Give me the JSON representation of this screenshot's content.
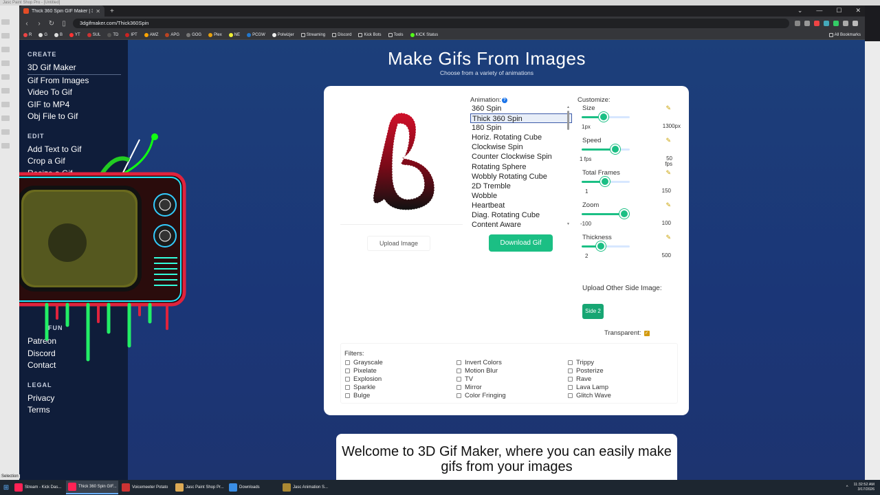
{
  "bg_app": {
    "title": "Jasc Paint Shop Pro - [Untitled]",
    "status": "Selection"
  },
  "browser": {
    "tab_title": "Thick 360 Spin GIF Maker | 3D GIF Maker",
    "url": "3dgifmaker.com/Thick360Spin",
    "bookmarks": [
      "R",
      "G",
      "B",
      "YT",
      "SUL",
      "TD",
      "IPT",
      "AMZ",
      "APG",
      "GOG",
      "Plex",
      "NE",
      "PCGW",
      "Polwizjer",
      "Streaming",
      "Discord",
      "Kick Bots",
      "Tools",
      "KICK Status"
    ],
    "all_bookmarks": "All Bookmarks"
  },
  "sidebar": {
    "create_title": "CREATE",
    "create_links": [
      "3D Gif Maker",
      "Gif From Images",
      "Video To Gif",
      "GIF to MP4",
      "Obj File to Gif"
    ],
    "edit_title": "EDIT",
    "edit_links": [
      "Add Text to Gif",
      "Crop a Gif",
      "Resize a Gif"
    ],
    "fun_title": "FUN",
    "fun_links": [
      "Patreon",
      "Discord",
      "Contact"
    ],
    "legal_title": "LEGAL",
    "legal_links": [
      "Privacy",
      "Terms"
    ]
  },
  "main": {
    "title": "Make Gifs From Images",
    "subtitle": "Choose from a variety of animations",
    "upload_image": "Upload Image",
    "animation_label": "Animation:",
    "animations": [
      "360 Spin",
      "Thick 360 Spin",
      "180 Spin",
      "Horiz. Rotating Cube",
      "Clockwise Spin",
      "Counter Clockwise Spin",
      "Rotating Sphere",
      "Wobbly Rotating Cube",
      "2D Tremble",
      "Wobble",
      "Heartbeat",
      "Diag. Rotating Cube",
      "Content Aware"
    ],
    "selected_animation": "Thick 360 Spin",
    "download_gif": "Download Gif",
    "customize_label": "Customize:",
    "sliders": [
      {
        "name": "Size",
        "min": "1px",
        "max": "1300px",
        "fraction": 0.45
      },
      {
        "name": "Speed",
        "min": "1 fps",
        "max": "50 fps",
        "fraction": 0.7
      },
      {
        "name": "Total Frames",
        "min": "1",
        "max": "150",
        "fraction": 0.48
      },
      {
        "name": "Zoom",
        "min": "-100",
        "max": "100",
        "fraction": 0.88
      },
      {
        "name": "Thickness",
        "min": "2",
        "max": "500",
        "fraction": 0.4
      }
    ],
    "upload_other_side": "Upload Other Side Image:",
    "side2": "Side 2",
    "transparent_label": "Transparent:",
    "filters_label": "Filters:",
    "filters": [
      [
        "Grayscale",
        "Pixelate",
        "Explosion",
        "Sparkle",
        "Bulge"
      ],
      [
        "Invert Colors",
        "Motion Blur",
        "TV",
        "Mirror",
        "Color Fringing"
      ],
      [
        "Trippy",
        "Posterize",
        "Rave",
        "Lava Lamp",
        "Glitch Wave"
      ]
    ],
    "welcome": "Welcome to 3D Gif Maker, where you can easily make gifs from your images"
  },
  "taskbar": {
    "items": [
      "Stream - Kick Das...",
      "Thick 360 Spin GIF...",
      "Voicemeeter Potato",
      "Jasc Paint Shop Pr...",
      "Downloads",
      "Jasc Animation S..."
    ],
    "time": "11:32:52 AM",
    "date": "3/17/2026"
  }
}
